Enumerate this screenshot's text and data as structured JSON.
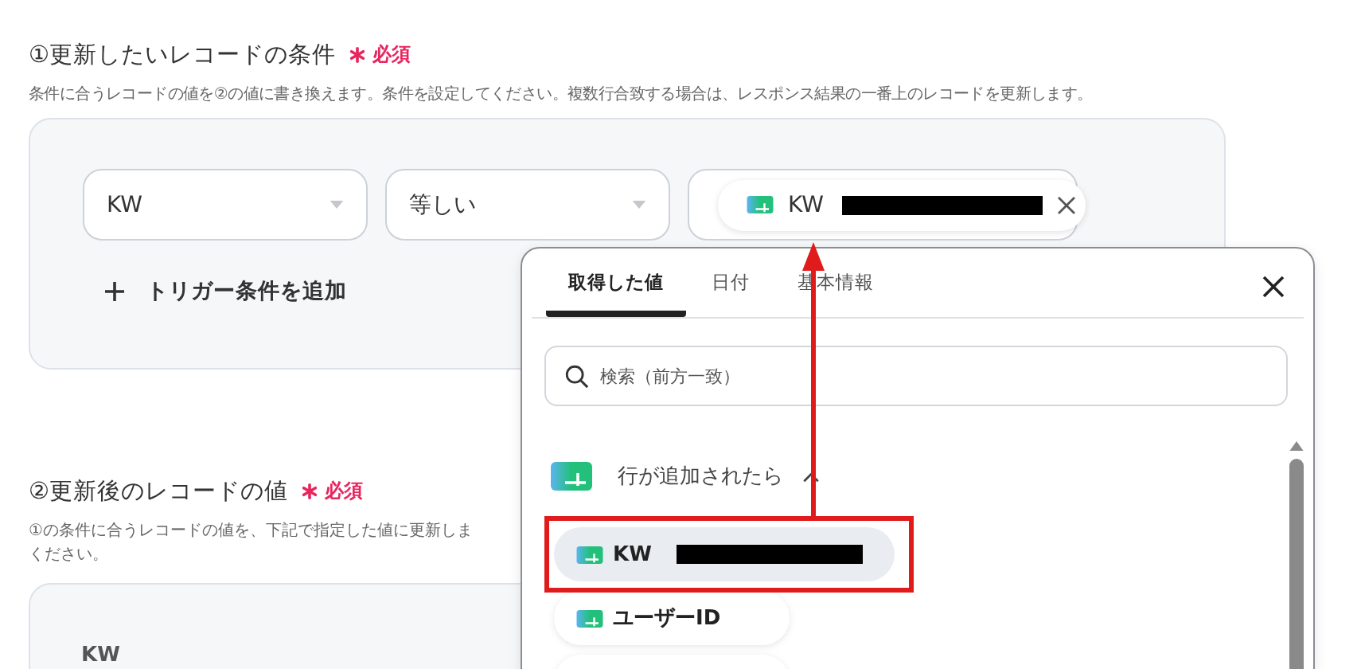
{
  "section1": {
    "title": "①更新したいレコードの条件",
    "required": "必須",
    "description": "条件に合うレコードの値を②の値に書き換えます。条件を設定してください。複数行合致する場合は、レスポンス結果の一番上のレコードを更新します。"
  },
  "condition": {
    "field": "KW",
    "operator": "等しい",
    "value": {
      "label": "KW",
      "redacted": true
    }
  },
  "add_condition": {
    "label": "トリガー条件を追加"
  },
  "section2": {
    "title": "②更新後のレコードの値",
    "required": "必須",
    "description_lines": [
      "①の条件に合うレコードの値を、下記で指定した値に更新しま",
      "ください。"
    ],
    "field_label": "KW"
  },
  "popup": {
    "tabs": [
      {
        "label": "取得した値",
        "selected": true
      },
      {
        "label": "日付",
        "selected": false
      },
      {
        "label": "基本情報",
        "selected": false
      }
    ],
    "search": {
      "placeholder": "検索（前方一致）"
    },
    "group": {
      "label": "行が追加されたら",
      "expanded": true
    },
    "items": [
      {
        "label": "KW",
        "redacted": true,
        "selected": true
      },
      {
        "label": "ユーザーID",
        "redacted": false,
        "selected": false
      }
    ]
  }
}
